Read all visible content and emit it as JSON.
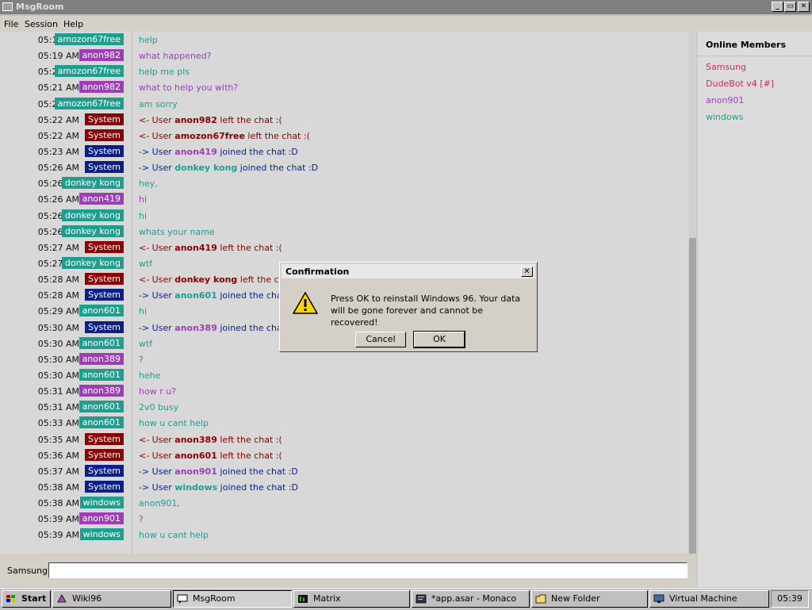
{
  "window": {
    "title": "MsgRoom",
    "min": "_",
    "max": "▭",
    "close": "✕"
  },
  "menu": [
    "File",
    "Session",
    "Help"
  ],
  "colors": {
    "amozon67free": "#1f9e8f",
    "anon982": "#9b3fb5",
    "System_left": "#8b0000",
    "System_join": "#0a1f8a",
    "donkey kong": "#1f9e8f",
    "anon419": "#9b3fb5",
    "anon601": "#1f9e8f",
    "anon389": "#9b3fb5",
    "anon901": "#9b3fb5",
    "windows": "#1f9e8f"
  },
  "messages": [
    {
      "time": "05:19 AM",
      "user": "amozon67free",
      "color": "#1f9e8f",
      "text": "help",
      "textcolor": "#1f9e8f"
    },
    {
      "time": "05:19 AM",
      "user": "anon982",
      "color": "#9b3fb5",
      "text": "what happened?",
      "textcolor": "#9b3fb5"
    },
    {
      "time": "05:20 AM",
      "user": "amozon67free",
      "color": "#1f9e8f",
      "text": "help me pls",
      "textcolor": "#1f9e8f"
    },
    {
      "time": "05:21 AM",
      "user": "anon982",
      "color": "#9b3fb5",
      "text": "what to help you with?",
      "textcolor": "#9b3fb5"
    },
    {
      "time": "05:21 AM",
      "user": "amozon67free",
      "color": "#1f9e8f",
      "text": "am sorry",
      "textcolor": "#1f9e8f"
    },
    {
      "time": "05:22 AM",
      "user": "System",
      "color": "#8b0000",
      "pre": "<- User ",
      "name": "anon982",
      "post": " left the chat :(",
      "textcolor": "#8b0000"
    },
    {
      "time": "05:22 AM",
      "user": "System",
      "color": "#8b0000",
      "pre": "<- User ",
      "name": "amozon67free",
      "post": " left the chat :(",
      "textcolor": "#8b0000"
    },
    {
      "time": "05:23 AM",
      "user": "System",
      "color": "#0a1f8a",
      "pre": "-> User ",
      "name": "anon419",
      "post": " joined the chat :D",
      "textcolor": "#0a1f8a",
      "namecolor": "#9b3fb5"
    },
    {
      "time": "05:26 AM",
      "user": "System",
      "color": "#0a1f8a",
      "pre": "-> User ",
      "name": "donkey kong",
      "post": " joined the chat :D",
      "textcolor": "#0a1f8a",
      "namecolor": "#1f9e8f"
    },
    {
      "time": "05:26 AM",
      "user": "donkey kong",
      "color": "#1f9e8f",
      "text": "hey,",
      "textcolor": "#1f9e8f"
    },
    {
      "time": "05:26 AM",
      "user": "anon419",
      "color": "#9b3fb5",
      "text": "hi",
      "textcolor": "#9b3fb5"
    },
    {
      "time": "05:26 AM",
      "user": "donkey kong",
      "color": "#1f9e8f",
      "text": "hi",
      "textcolor": "#1f9e8f"
    },
    {
      "time": "05:26 AM",
      "user": "donkey kong",
      "color": "#1f9e8f",
      "text": "whats your name",
      "textcolor": "#1f9e8f"
    },
    {
      "time": "05:27 AM",
      "user": "System",
      "color": "#8b0000",
      "pre": "<- User ",
      "name": "anon419",
      "post": " left the chat :(",
      "textcolor": "#8b0000"
    },
    {
      "time": "05:27 AM",
      "user": "donkey kong",
      "color": "#1f9e8f",
      "text": "wtf",
      "textcolor": "#1f9e8f"
    },
    {
      "time": "05:28 AM",
      "user": "System",
      "color": "#8b0000",
      "pre": "<- User ",
      "name": "donkey kong",
      "post": " left the chat :(",
      "textcolor": "#8b0000"
    },
    {
      "time": "05:28 AM",
      "user": "System",
      "color": "#0a1f8a",
      "pre": "-> User ",
      "name": "anon601",
      "post": " joined the chat :D",
      "textcolor": "#0a1f8a",
      "namecolor": "#1f9e8f"
    },
    {
      "time": "05:29 AM",
      "user": "anon601",
      "color": "#1f9e8f",
      "text": "hi",
      "textcolor": "#1f9e8f"
    },
    {
      "time": "05:30 AM",
      "user": "System",
      "color": "#0a1f8a",
      "pre": "-> User ",
      "name": "anon389",
      "post": " joined the chat :D",
      "textcolor": "#0a1f8a",
      "namecolor": "#9b3fb5"
    },
    {
      "time": "05:30 AM",
      "user": "anon601",
      "color": "#1f9e8f",
      "text": "wtf",
      "textcolor": "#1f9e8f"
    },
    {
      "time": "05:30 AM",
      "user": "anon389",
      "color": "#9b3fb5",
      "text": "?",
      "textcolor": "#9b3fb5"
    },
    {
      "time": "05:30 AM",
      "user": "anon601",
      "color": "#1f9e8f",
      "text": "hehe",
      "textcolor": "#1f9e8f"
    },
    {
      "time": "05:31 AM",
      "user": "anon389",
      "color": "#9b3fb5",
      "text": "how r u?",
      "textcolor": "#9b3fb5"
    },
    {
      "time": "05:31 AM",
      "user": "anon601",
      "color": "#1f9e8f",
      "text": "2v0 busy",
      "textcolor": "#1f9e8f"
    },
    {
      "time": "05:33 AM",
      "user": "anon601",
      "color": "#1f9e8f",
      "text": "how u cant help",
      "textcolor": "#1f9e8f"
    },
    {
      "time": "05:35 AM",
      "user": "System",
      "color": "#8b0000",
      "pre": "<- User ",
      "name": "anon389",
      "post": " left the chat :(",
      "textcolor": "#8b0000"
    },
    {
      "time": "05:36 AM",
      "user": "System",
      "color": "#8b0000",
      "pre": "<- User ",
      "name": "anon601",
      "post": " left the chat :(",
      "textcolor": "#8b0000"
    },
    {
      "time": "05:37 AM",
      "user": "System",
      "color": "#0a1f8a",
      "pre": "-> User ",
      "name": "anon901",
      "post": " joined the chat :D",
      "textcolor": "#0a1f8a",
      "namecolor": "#9b3fb5"
    },
    {
      "time": "05:38 AM",
      "user": "System",
      "color": "#0a1f8a",
      "pre": "-> User ",
      "name": "windows",
      "post": " joined the chat :D",
      "textcolor": "#0a1f8a",
      "namecolor": "#1f9e8f"
    },
    {
      "time": "05:38 AM",
      "user": "windows",
      "color": "#1f9e8f",
      "text": "anon901,",
      "textcolor": "#1f9e8f"
    },
    {
      "time": "05:39 AM",
      "user": "anon901",
      "color": "#9b3fb5",
      "text": "?",
      "textcolor": "#9b3fb5"
    },
    {
      "time": "05:39 AM",
      "user": "windows",
      "color": "#1f9e8f",
      "text": "how u cant help",
      "textcolor": "#1f9e8f"
    }
  ],
  "members": {
    "title": "Online Members",
    "list": [
      {
        "name": "Samsung",
        "color": "#d6285a"
      },
      {
        "name": "DudeBot v4 [#]",
        "color": "#d6285a"
      },
      {
        "name": "anon901",
        "color": "#9b3fb5"
      },
      {
        "name": "windows",
        "color": "#1f9e8f"
      }
    ]
  },
  "input": {
    "label": "Samsung",
    "value": "",
    "placeholder": ""
  },
  "dialog": {
    "title": "Confirmation",
    "close": "✕",
    "line1": "Press OK to reinstall Windows 96. Your data",
    "line2": "will be gone forever and cannot be recovered!",
    "cancel": "Cancel",
    "ok": "OK",
    "icon": "warning-icon"
  },
  "taskbar": {
    "start": "Start",
    "tasks": [
      {
        "label": "Wiki96",
        "icon": "wiki-icon"
      },
      {
        "label": "MsgRoom",
        "icon": "chat-icon",
        "active": true
      },
      {
        "label": "Matrix",
        "icon": "matrix-icon"
      },
      {
        "label": "*app.asar - Monaco",
        "icon": "editor-icon"
      },
      {
        "label": "New Folder",
        "icon": "folder-icon"
      },
      {
        "label": "Virtual Machine",
        "icon": "monitor-icon"
      }
    ],
    "clock": "05:39"
  }
}
